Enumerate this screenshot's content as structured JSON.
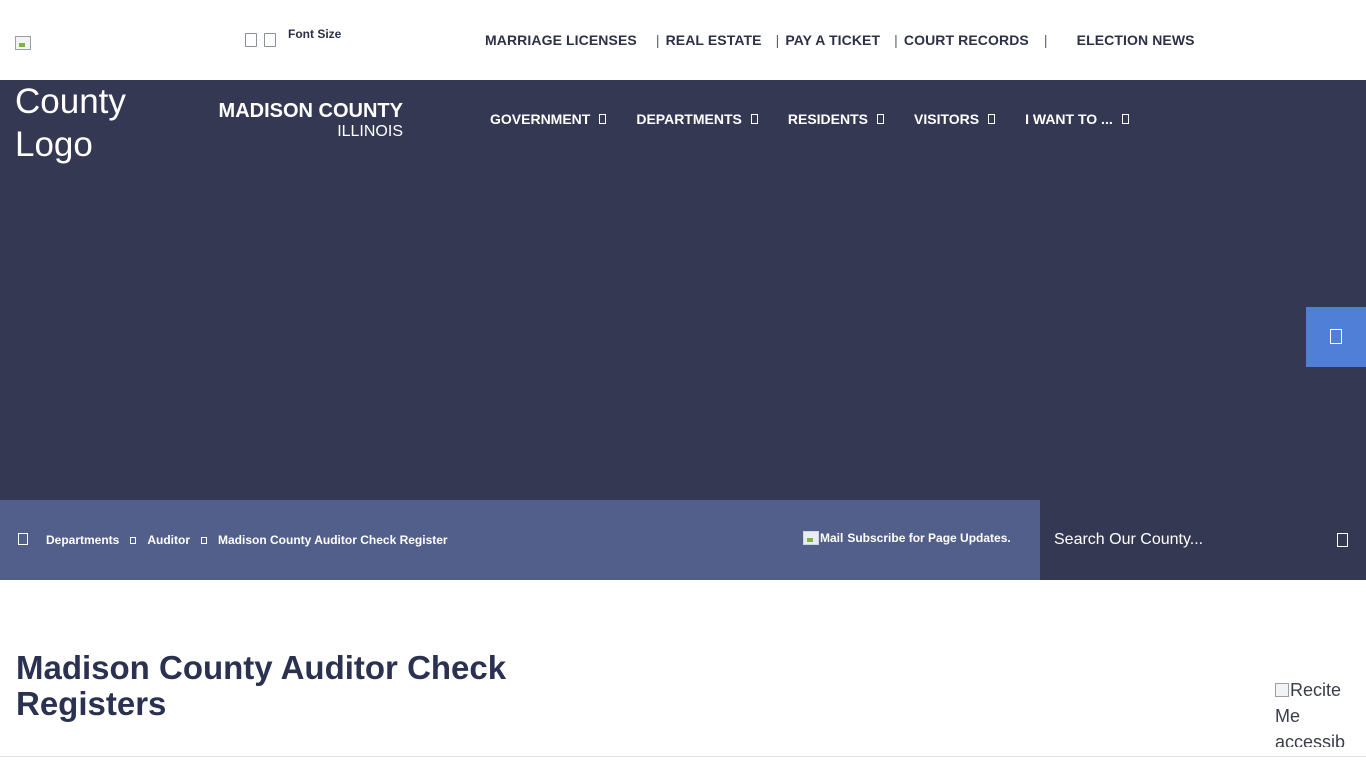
{
  "topbar": {
    "font_size_label": "Font Size",
    "links": [
      {
        "label": "MARRIAGE LICENSES"
      },
      {
        "label": "REAL ESTATE"
      },
      {
        "label": "PAY A TICKET"
      },
      {
        "label": "COURT RECORDS"
      },
      {
        "label": "ELECTION NEWS"
      }
    ],
    "separator": "|"
  },
  "header": {
    "logo_alt": "County Logo",
    "brand_name": "MADISON COUNTY",
    "brand_state": "ILLINOIS",
    "nav": [
      {
        "label": "GOVERNMENT"
      },
      {
        "label": "DEPARTMENTS"
      },
      {
        "label": "RESIDENTS"
      },
      {
        "label": "VISITORS"
      },
      {
        "label": "I WANT TO ..."
      }
    ]
  },
  "breadcrumb": {
    "items": [
      {
        "label": "Departments"
      },
      {
        "label": "Auditor"
      },
      {
        "label": "Madison County Auditor Check Register"
      }
    ],
    "subscribe_alt": "Mail",
    "subscribe_label": "Subscribe for Page Updates."
  },
  "search": {
    "placeholder": "Search Our County..."
  },
  "main": {
    "title": "Madison County Auditor Check Registers",
    "recite_alt": "Recite Me accessib"
  },
  "colors": {
    "header_bg": "#353853",
    "breadcrumb_bg": "#525f8a",
    "side_tab": "#4f7fd6",
    "title_text": "#2b3150"
  },
  "icons": {
    "font_decrease": "font-decrease-icon",
    "font_increase": "font-increase-icon",
    "home": "home-icon",
    "search": "search-icon",
    "side_tab": "accessibility-icon"
  }
}
